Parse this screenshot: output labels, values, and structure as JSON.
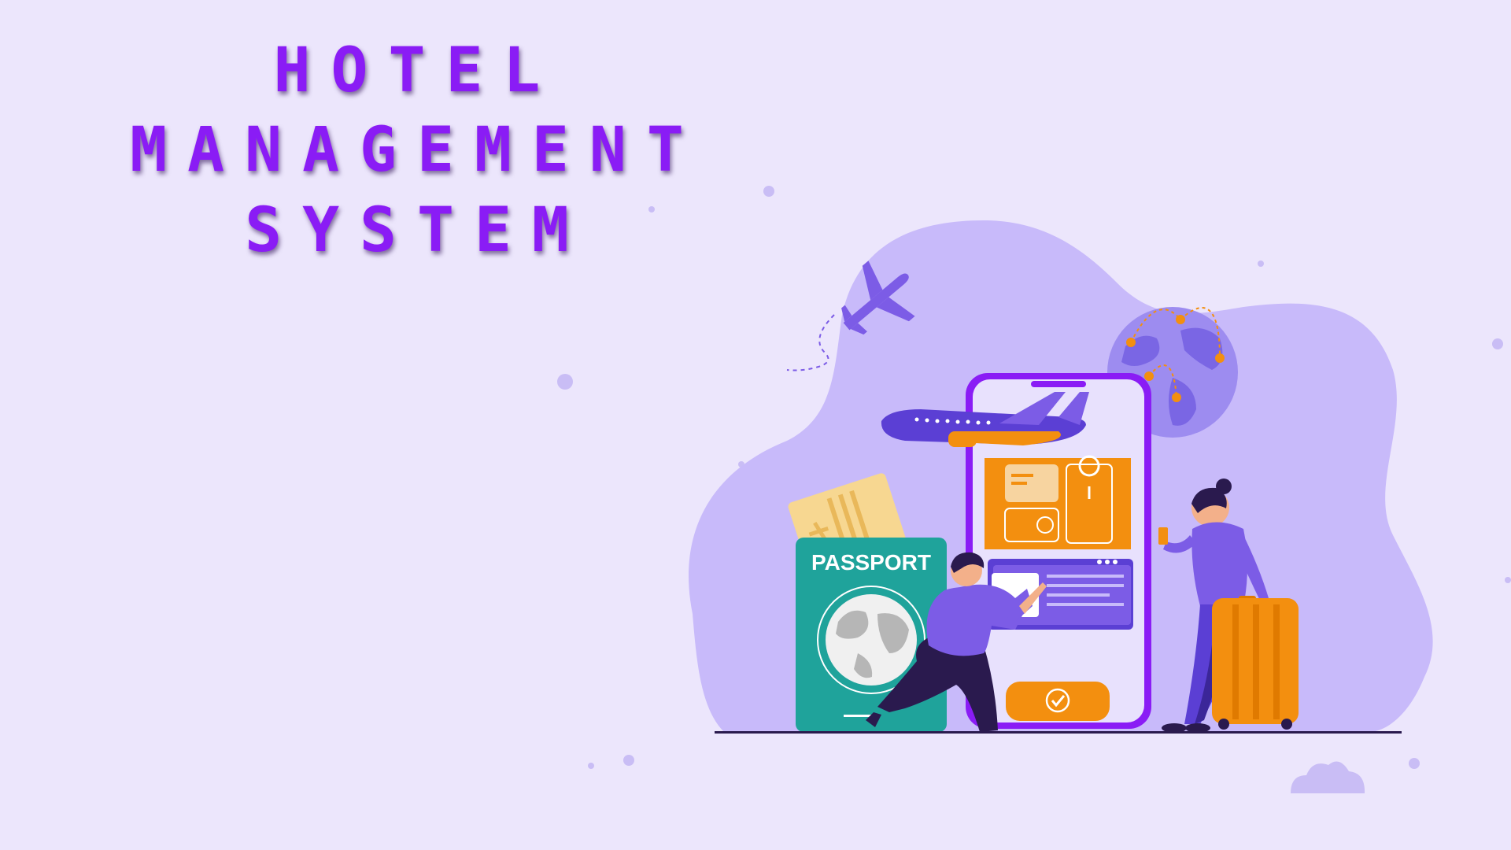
{
  "title": {
    "line1": "HOTEL MANAGEMENT",
    "line2": "SYSTEM"
  },
  "illustration": {
    "passport_label": "PASSPORT",
    "icons": [
      "airplane-icon",
      "globe-icon",
      "location-pin-icon",
      "ticket-icon",
      "smartphone-icon",
      "checkmark-icon",
      "suitcase-icon",
      "cloud-icon"
    ]
  },
  "colors": {
    "background": "#ece6fc",
    "title": "#8a1cf5",
    "blob": "#c8bafa",
    "accent_purple": "#7c5ce6",
    "accent_orange": "#f38f0f",
    "passport_teal": "#1fa39b",
    "dark_navy": "#2a1a4e"
  }
}
